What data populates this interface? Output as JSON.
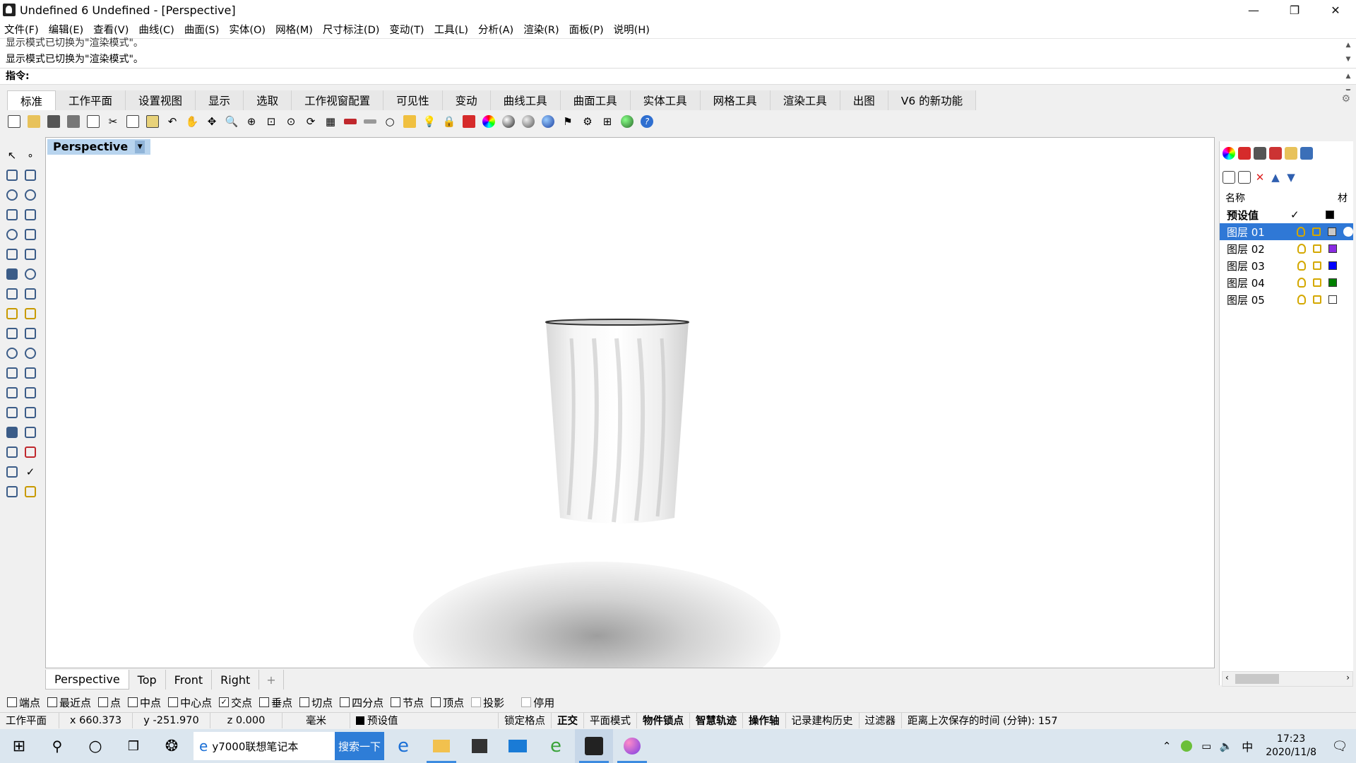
{
  "window": {
    "title": "Undefined 6 Undefined - [Perspective]",
    "controls": {
      "minimize": "—",
      "restore": "❐",
      "close": "✕"
    }
  },
  "menu": [
    "文件(F)",
    "编辑(E)",
    "查看(V)",
    "曲线(C)",
    "曲面(S)",
    "实体(O)",
    "网格(M)",
    "尺寸标注(D)",
    "变动(T)",
    "工具(L)",
    "分析(A)",
    "渲染(R)",
    "面板(P)",
    "说明(H)"
  ],
  "history": {
    "line1": "显示模式已切换为\"渲染模式\"。",
    "line2": "显示模式已切换为\"渲染模式\"。"
  },
  "command": {
    "label": "指令:"
  },
  "toolbar_tabs": [
    "标准",
    "工作平面",
    "设置视图",
    "显示",
    "选取",
    "工作视窗配置",
    "可见性",
    "变动",
    "曲线工具",
    "曲面工具",
    "实体工具",
    "网格工具",
    "渲染工具",
    "出图",
    "V6 的新功能"
  ],
  "toolbar_icons": [
    "new-icon",
    "open-icon",
    "save-icon",
    "print-icon",
    "import-icon",
    "cut-icon",
    "copy-icon",
    "paste-icon",
    "undo-icon",
    "pan-icon",
    "move-view-icon",
    "zoom-window-icon",
    "zoom-extents-icon",
    "zoom-selected-icon",
    "zoom-icon",
    "rotate-view-icon",
    "four-views-icon",
    "car-icon",
    "tool-icon",
    "circle-icon",
    "select-icon",
    "bulb-icon",
    "lock-icon",
    "layer-icon",
    "color-wheel-icon",
    "sphere-icon",
    "render-sphere-icon",
    "material-icon",
    "flag-icon",
    "gear-icon",
    "grid-icon",
    "globe-icon",
    "help-icon"
  ],
  "viewport": {
    "label": "Perspective",
    "dropdown": "▼"
  },
  "viewport_tabs": [
    "Perspective",
    "Top",
    "Front",
    "Right"
  ],
  "viewport_tab_add": "+",
  "layers_panel": {
    "header_name": "名称",
    "header_mat": "材",
    "default": {
      "name": "预设值",
      "check": "✓"
    },
    "layers": [
      {
        "name": "图层 01",
        "color": "#c8c8c8",
        "selected": true
      },
      {
        "name": "图层 02",
        "color": "#8a2be2",
        "selected": false
      },
      {
        "name": "图层 03",
        "color": "#0000ff",
        "selected": false
      },
      {
        "name": "图层 04",
        "color": "#008000",
        "selected": false
      },
      {
        "name": "图层 05",
        "color": "#ffffff",
        "selected": false
      }
    ]
  },
  "osnaps": [
    {
      "label": "端点",
      "checked": false
    },
    {
      "label": "最近点",
      "checked": false
    },
    {
      "label": "点",
      "checked": false
    },
    {
      "label": "中点",
      "checked": false
    },
    {
      "label": "中心点",
      "checked": false
    },
    {
      "label": "交点",
      "checked": true
    },
    {
      "label": "垂点",
      "checked": false
    },
    {
      "label": "切点",
      "checked": false
    },
    {
      "label": "四分点",
      "checked": false
    },
    {
      "label": "节点",
      "checked": false
    },
    {
      "label": "顶点",
      "checked": false
    },
    {
      "label": "投影",
      "checked": false,
      "disabled": true
    },
    {
      "label": "停用",
      "checked": false,
      "disabled": true
    }
  ],
  "status": {
    "cplane": "工作平面",
    "x": "x 660.373",
    "y": "y -251.970",
    "z": "z 0.000",
    "units": "毫米",
    "layer": "预设值",
    "grid_snap": "锁定格点",
    "ortho": "正交",
    "planar": "平面模式",
    "osnap": "物件锁点",
    "smarttrack": "智慧轨迹",
    "gumball": "操作轴",
    "history": "记录建构历史",
    "filter": "过滤器",
    "autosave": "距离上次保存的时间 (分钟): 157"
  },
  "taskbar": {
    "search_text": "y7000联想笔记本",
    "search_button": "搜索一下",
    "ime": "中",
    "time": "17:23",
    "date": "2020/11/8"
  }
}
